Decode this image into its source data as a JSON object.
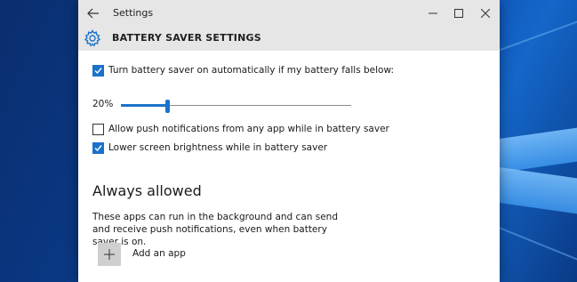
{
  "window": {
    "title": "Settings",
    "controls": {
      "minimize_icon": "minimize-icon",
      "maximize_icon": "maximize-icon",
      "close_icon": "close-icon"
    }
  },
  "header": {
    "icon": "gear-icon",
    "title": "BATTERY SAVER SETTINGS"
  },
  "auto_on": {
    "checked": true,
    "label": "Turn battery saver on automatically if my battery falls below:"
  },
  "threshold_slider": {
    "value_label": "20%",
    "value": 20,
    "min": 0,
    "max": 100
  },
  "options": [
    {
      "checked": false,
      "label": "Allow push notifications from any app while in battery saver"
    },
    {
      "checked": true,
      "label": "Lower screen brightness while in battery saver"
    }
  ],
  "always_allowed": {
    "heading": "Always allowed",
    "description": "These apps can run in the background and can send and receive push notifications, even when battery saver is on.",
    "add_button_label": "Add an app"
  },
  "colors": {
    "accent": "#1a73c9",
    "titlebar": "#e6e6e6"
  }
}
